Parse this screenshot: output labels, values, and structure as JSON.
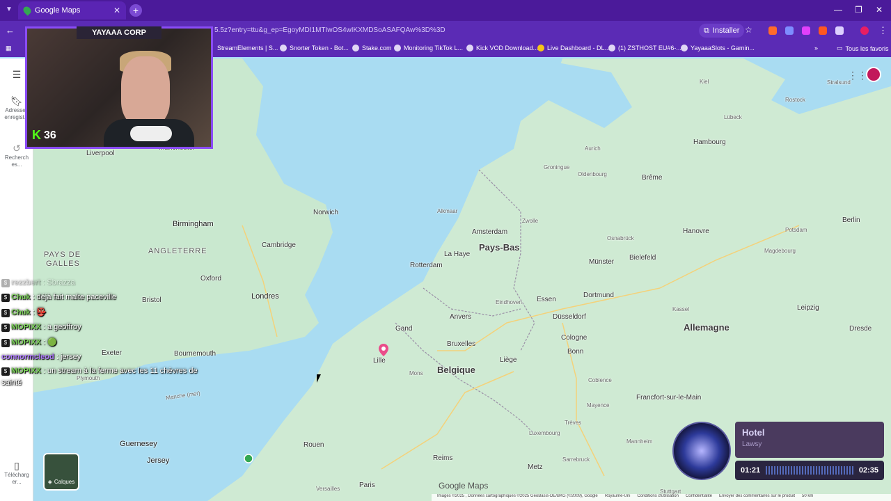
{
  "browser": {
    "tab_title": "Google Maps",
    "url": "5.5z?entry=ttu&g_ep=EgoyMDI1MTIwOS4wIKXMDSoASAFQAw%3D%3D",
    "install_label": "Installer",
    "bookmarks": [
      "StreamElements | S...",
      "Snorter Token - Bot...",
      "Stake.com",
      "Monitoring TikTok L...",
      "Kick VOD Download...",
      "Live Dashboard - DL...",
      "(1) ZSTHOST EU#6-...",
      "YayaaaSlots - Gamin..."
    ],
    "all_favorites": "Tous les favoris"
  },
  "maps": {
    "rail": {
      "saved": "Adresses enregist...",
      "recents": "Recherch es...",
      "download": "Télécharg er..."
    },
    "layers_label": "Calques",
    "logo": "Google Maps",
    "footer": [
      "Images ©2025 , Données cartographiques ©2025 GeoBasis-DE/BKG (©2009), Google",
      "Royaume-Uni",
      "Conditions d'utilisation",
      "Confidentialité",
      "Envoyer des commentaires sur le produit",
      "50 km"
    ],
    "labels": {
      "countries": [
        "Pays-Bas",
        "Belgique",
        "Allemagne"
      ],
      "regions": [
        "ANGLETERRE",
        "PAYS DE",
        "GALLES"
      ],
      "cities": [
        "Liverpool",
        "Manchester",
        "Birmingham",
        "Norwich",
        "Cambridge",
        "Oxford",
        "Londres",
        "Bristol",
        "Exeter",
        "Bournemouth",
        "Plymouth",
        "Guernesey",
        "Jersey",
        "Rouen",
        "Paris",
        "Versailles",
        "Reims",
        "Metz",
        "Lille",
        "Gand",
        "Anvers",
        "Bruxelles",
        "Mons",
        "Liège",
        "Eindhoven",
        "Essen",
        "Dortmund",
        "Düsseldorf",
        "Cologne",
        "Bonn",
        "Coblence",
        "Mayence",
        "Francfort-sur-le-Main",
        "Trèves",
        "Luxembourg",
        "Mannheim",
        "Sarrebruck",
        "Stuttgart",
        "Rotterdam",
        "La Haye",
        "Amsterdam",
        "Alkmaar",
        "Zwolle",
        "Groningue",
        "Oldenbourg",
        "Brême",
        "Hambourg",
        "Kiel",
        "Lübeck",
        "Rostock",
        "Stralsund",
        "Hanovre",
        "Osnabrück",
        "Münster",
        "Bielefeld",
        "Magdebourg",
        "Potsdam",
        "Berlin",
        "Kassel",
        "Leipzig",
        "Dresde",
        "Aurich"
      ],
      "sea": "Manche (mer)"
    }
  },
  "stream": {
    "cam_title": "YAYAAA CORP",
    "viewers": "36",
    "chat": [
      {
        "user": "rezzbert",
        "text": ": Sbrazza",
        "color": "#9a9a9a",
        "faded": true
      },
      {
        "user": "Chuk",
        "text": ": déjà fait malte paceville",
        "color": "#7cd35a"
      },
      {
        "user": "Chuk",
        "text": ": 👺",
        "color": "#7cd35a"
      },
      {
        "user": "MOPIXX",
        "text": ": a geoffroy",
        "color": "#7cd35a"
      },
      {
        "user": "MOPIXX",
        "text": ": 🟢",
        "color": "#7cd35a"
      },
      {
        "user": "connormcleod",
        "text": ": jersey",
        "color": "#b07cff"
      },
      {
        "user": "MOPIXX",
        "text": ": un stream à la ferme avec les 11 chèvres de",
        "color": "#7cd35a"
      },
      {
        "user": "",
        "text": "sainté",
        "color": "#ffffff"
      }
    ]
  },
  "player": {
    "title": "Hotel",
    "artist": "Lawsy",
    "elapsed": "01:21",
    "duration": "02:35"
  }
}
